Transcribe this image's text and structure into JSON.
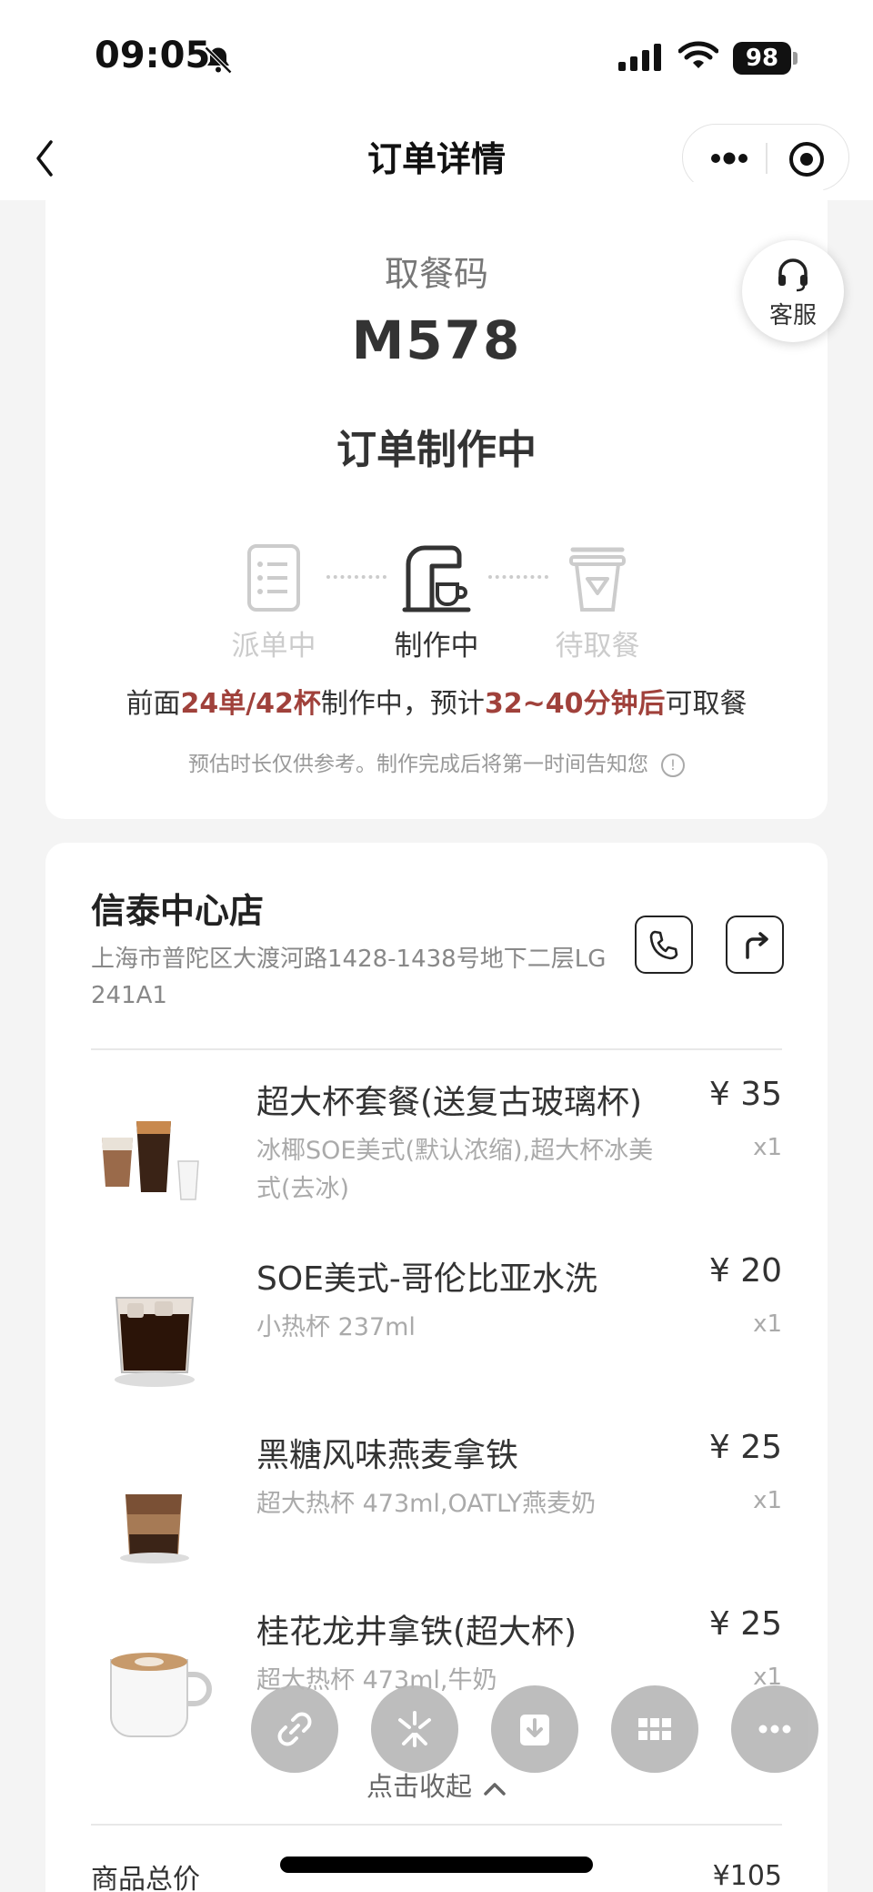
{
  "status_bar": {
    "time": "09:05",
    "battery": "98"
  },
  "nav": {
    "title": "订单详情",
    "back_icon": "chevron-left-icon",
    "more_icon": "ellipsis-icon",
    "target_icon": "target-icon"
  },
  "order": {
    "pickup_label": "取餐码",
    "pickup_code": "M578",
    "status": "订单制作中",
    "service_label": "客服",
    "steps": [
      {
        "label": "派单中",
        "icon": "list-icon",
        "active": false
      },
      {
        "label": "制作中",
        "icon": "coffee-machine-icon",
        "active": true
      },
      {
        "label": "待取餐",
        "icon": "cup-icon",
        "active": false
      }
    ],
    "eta": {
      "prefix": "前面",
      "queue": "24单/42杯",
      "middle": "制作中，预计",
      "time": "32~40分钟后",
      "suffix": "可取餐"
    },
    "note": "预估时长仅供参考。制作完成后将第一时间告知您",
    "note_icon": "!"
  },
  "store": {
    "name": "信泰中心店",
    "address": "上海市普陀区大渡河路1428-1438号地下二层LG 241A1",
    "phone_icon": "phone-icon",
    "navigate_icon": "turn-right-arrow-icon"
  },
  "items": [
    {
      "name": "超大杯套餐(送复古玻璃杯)",
      "price": "¥ 35",
      "spec": "冰椰SOE美式(默认浓缩),超大杯冰美式(去冰)",
      "qty": "x1"
    },
    {
      "name": "SOE美式-哥伦比亚水洗",
      "price": "¥ 20",
      "spec": "小热杯 237ml",
      "qty": "x1"
    },
    {
      "name": "黑糖风味燕麦拿铁",
      "price": "¥ 25",
      "spec": "超大热杯 473ml,OATLY燕麦奶",
      "qty": "x1"
    },
    {
      "name": "桂花龙井拿铁(超大杯)",
      "price": "¥ 25",
      "spec": "超大热杯 473ml,牛奶",
      "qty": "x1"
    }
  ],
  "floating_actions": [
    "link-icon",
    "sparkle-icon",
    "download-icon",
    "grid-icon",
    "more-icon"
  ],
  "collapse_label": "点击收起",
  "summary": {
    "label": "商品总价",
    "value": "¥105"
  },
  "colors": {
    "highlight": "#a0413b",
    "muted": "#aaaaaa",
    "text": "#333333"
  }
}
